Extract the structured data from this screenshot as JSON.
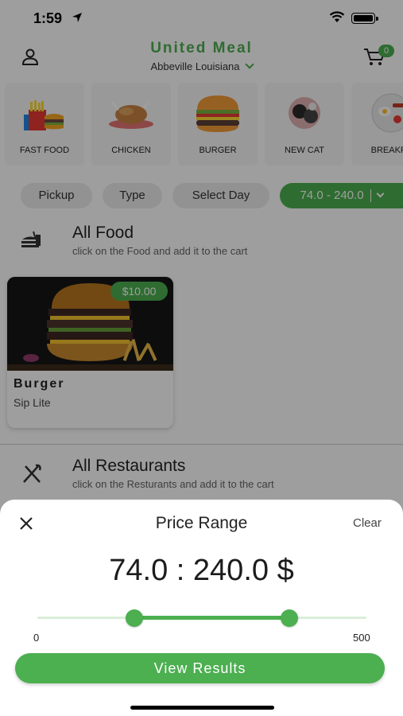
{
  "status_bar": {
    "time": "1:59"
  },
  "header": {
    "title": "United Meal",
    "location": "Abbeville Louisiana",
    "cart_count": "0"
  },
  "categories": [
    {
      "label": "FAST FOOD",
      "icon": "fast-food-icon"
    },
    {
      "label": "CHICKEN",
      "icon": "chicken-icon"
    },
    {
      "label": "BURGER",
      "icon": "burger-icon"
    },
    {
      "label": "NEW CAT",
      "icon": "new-cat-icon"
    },
    {
      "label": "BREAKFA",
      "icon": "breakfast-icon"
    }
  ],
  "filters": {
    "pickup": "Pickup",
    "type": "Type",
    "select_day": "Select Day",
    "price": "74.0 - 240.0"
  },
  "all_food": {
    "title": "All Food",
    "subtitle": "click on the Food and add it to the cart"
  },
  "food_items": [
    {
      "price": "$10.00",
      "name": "Burger",
      "restaurant": "Sip Lite"
    }
  ],
  "all_restaurants": {
    "title": "All Restaurants",
    "subtitle": "click on the Resturants and add it to the cart"
  },
  "price_sheet": {
    "title": "Price Range",
    "clear_label": "Clear",
    "range_text": "74.0 : 240.0 $",
    "min_label": "0",
    "max_label": "500",
    "range_min": 0,
    "range_max": 500,
    "selected_low": 74,
    "selected_high": 240,
    "view_results_label": "View Results"
  },
  "colors": {
    "accent": "#4caf50"
  }
}
